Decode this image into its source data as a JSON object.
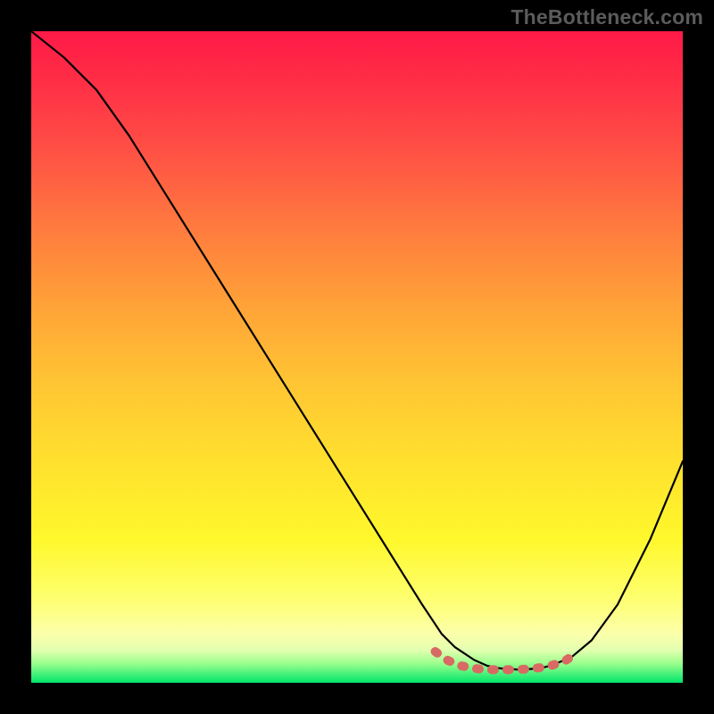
{
  "watermark": "TheBottleneck.com",
  "chart_data": {
    "type": "line",
    "title": "",
    "xlabel": "",
    "ylabel": "",
    "xlim": [
      0,
      100
    ],
    "ylim": [
      0,
      100
    ],
    "grid": false,
    "series": [
      {
        "name": "bottleneck-curve",
        "color": "#000000",
        "x": [
          0,
          5,
          10,
          15,
          20,
          25,
          30,
          35,
          40,
          45,
          50,
          55,
          60,
          63,
          65,
          68,
          70,
          72,
          75,
          78,
          80,
          83,
          86,
          90,
          95,
          100
        ],
        "y": [
          100,
          96,
          91,
          84,
          76,
          68,
          60,
          52,
          44,
          36,
          28,
          20,
          12,
          7.5,
          5.5,
          3.5,
          2.6,
          2.2,
          2.0,
          2.2,
          2.7,
          4.0,
          6.5,
          12,
          22,
          34
        ]
      },
      {
        "name": "bottom-red-band",
        "color": "#d86a63",
        "x": [
          62,
          64,
          66,
          68,
          70,
          72,
          74,
          76,
          78,
          80,
          82,
          84
        ],
        "y": [
          4.8,
          3.4,
          2.6,
          2.2,
          2.0,
          2.0,
          2.0,
          2.1,
          2.3,
          2.7,
          3.4,
          4.8
        ]
      }
    ],
    "gradient_stops": [
      {
        "pos": 0.0,
        "color": "#ff1a47"
      },
      {
        "pos": 0.3,
        "color": "#ff7a3e"
      },
      {
        "pos": 0.6,
        "color": "#ffd830"
      },
      {
        "pos": 0.88,
        "color": "#feff6a"
      },
      {
        "pos": 1.0,
        "color": "#00e66a"
      }
    ]
  }
}
